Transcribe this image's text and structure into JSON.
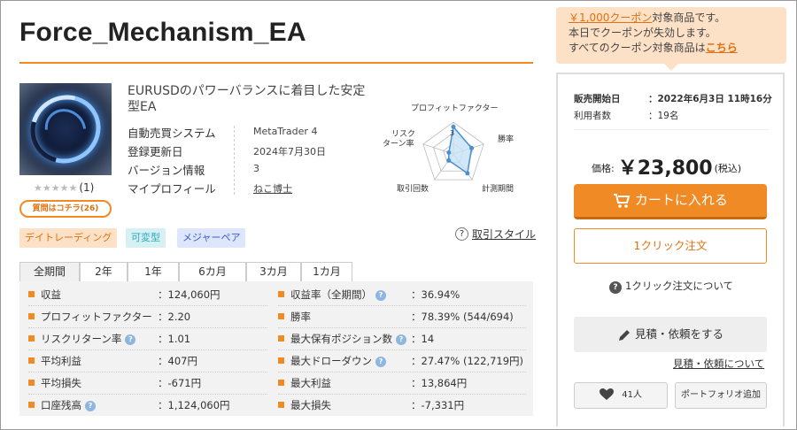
{
  "product": {
    "title": "Force_Mechanism_EA",
    "description": "EURUSDのパワーバランスに着目した安定型EA",
    "rating_stars": "★★★★★",
    "rating_count": "(1)",
    "question_label": "質問はコチラ(26)"
  },
  "specs": [
    {
      "key": "自動売買システム",
      "value": "MetaTrader 4"
    },
    {
      "key": "登録更新日",
      "value": "2024年7月30日"
    },
    {
      "key": "バージョン情報",
      "value": "3"
    },
    {
      "key": "マイプロフィール",
      "value": "ねこ博士"
    }
  ],
  "radar": {
    "labels": {
      "top": "プロフィットファクター",
      "right_top": "勝率",
      "left_top_1": "リスク",
      "left_top_2": "ターン率",
      "right_bottom": "計測期間",
      "left_bottom": "取引回数"
    },
    "center_number": "3",
    "values": [
      0.85,
      0.6,
      0.75,
      0.25,
      0.15
    ],
    "axis_order": [
      "profit_factor",
      "win_rate",
      "period",
      "trades",
      "risk_return"
    ],
    "colors": {
      "fill": "#c7e2f6",
      "stroke": "#4a90d0",
      "grid": "#bbbbbb"
    }
  },
  "tags": [
    "デイトレーディング",
    "可変型",
    "メジャーペア"
  ],
  "style_link": "取引スタイル",
  "tabs": [
    "全期間",
    "2年",
    "1年",
    "6カ月",
    "3カ月",
    "1カ月"
  ],
  "stats_left": [
    {
      "key": "収益",
      "value": "：124,060円",
      "help": false
    },
    {
      "key": "プロフィットファクター",
      "value": "：2.20",
      "help": false
    },
    {
      "key": "リスクリターン率",
      "value": "：1.01",
      "help": true
    },
    {
      "key": "平均利益",
      "value": "：407円",
      "help": false
    },
    {
      "key": "平均損失",
      "value": "：-671円",
      "help": false
    },
    {
      "key": "口座残高",
      "value": "：1,124,060円",
      "help": true
    }
  ],
  "stats_right": [
    {
      "key": "収益率（全期間）",
      "value": "：36.94%",
      "help": true
    },
    {
      "key": "勝率",
      "value": "：78.39% (544/694)",
      "help": false
    },
    {
      "key": "最大保有ポジション数",
      "value": "：14",
      "help": true
    },
    {
      "key": "最大ドローダウン",
      "value": "：27.47% (122,719円)",
      "help": true
    },
    {
      "key": "最大利益",
      "value": "：13,864円",
      "help": false
    },
    {
      "key": "最大損失",
      "value": "：-7,331円",
      "help": false
    }
  ],
  "coupon": {
    "highlight": "￥1,000クーポン",
    "line1_rest": "対象商品です。",
    "line2": "本日でクーポンが失効します。",
    "line3": "すべてのクーポン対象商品は",
    "link": "こちら"
  },
  "sale": {
    "start_label": "販売開始日",
    "start_value": "：2022年6月3日 11時16分",
    "users_label": "利用者数",
    "users_value": "：19名"
  },
  "price": {
    "label": "価格:",
    "amount": "￥23,800",
    "tax": "(税込)"
  },
  "buttons": {
    "cart": "カートに入れる",
    "one_click": "1クリック注文",
    "one_click_help": "1クリック注文について",
    "quote": "見積・依頼をする",
    "quote_link": "見積・依頼について",
    "likes": "41人",
    "portfolio": "ポートフォリオ追加"
  },
  "colors": {
    "accent": "#f08a24",
    "tag_day": "#fde1c6",
    "tag_variable": "#d6f0f4",
    "tag_major": "#dde6fb"
  }
}
